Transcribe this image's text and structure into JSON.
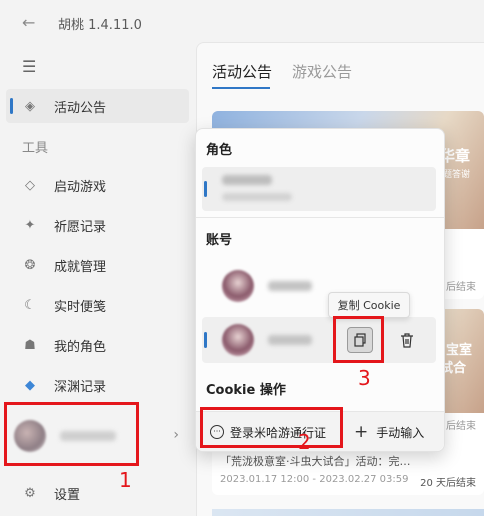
{
  "app": {
    "title": "胡桃 1.4.11.0",
    "back_icon": "arrow-left-icon"
  },
  "sidebar": {
    "menu_icon": "hamburger-icon",
    "top_items": [
      {
        "label": "活动公告",
        "icon": "compass-icon",
        "active": true
      }
    ],
    "section_label": "工具",
    "items": [
      {
        "label": "启动游戏",
        "icon": "diamond-icon"
      },
      {
        "label": "祈愿记录",
        "icon": "sparkle-icon"
      },
      {
        "label": "成就管理",
        "icon": "badge-icon"
      },
      {
        "label": "实时便笺",
        "icon": "moon-icon"
      },
      {
        "label": "我的角色",
        "icon": "character-icon"
      },
      {
        "label": "深渊记录",
        "icon": "abyss-icon"
      }
    ],
    "settings_label": "设置"
  },
  "main": {
    "tabs": [
      {
        "label": "活动公告",
        "active": true
      },
      {
        "label": "游戏公告",
        "active": false
      }
    ],
    "card1": {
      "partial_title": "华章",
      "partial_sub": "题答谢",
      "remaining": "后结束"
    },
    "card2": {
      "partial_title": "宝室",
      "partial_sub": "试合",
      "remaining_mid": "后结束",
      "desc": "「荒泷极意室·斗虫大试合」活动：完…",
      "dates": "2023.01.17 12:00 - 2023.02.27 03:59",
      "remaining": "20 天后结束"
    }
  },
  "flyout": {
    "role_header": "角色",
    "account_header": "账号",
    "cookie_header": "Cookie 操作",
    "tooltip": "复制 Cookie",
    "login_button": "登录米哈游通行证",
    "manual_button": "手动输入"
  },
  "annotations": {
    "n1": "1",
    "n2": "2",
    "n3": "3"
  },
  "colors": {
    "accent": "#2f77c6",
    "highlight": "#e4161b"
  }
}
